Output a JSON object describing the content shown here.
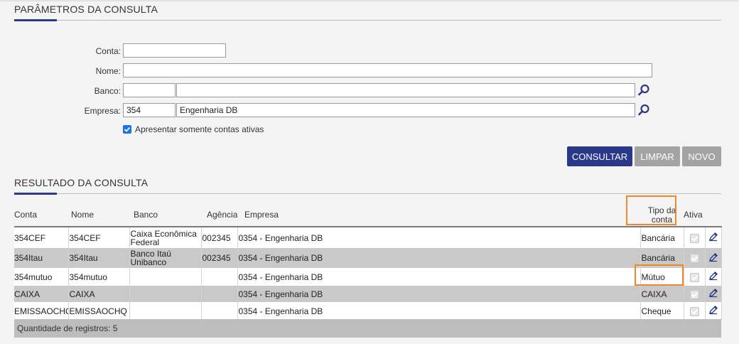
{
  "params": {
    "title": "PARÂMETROS DA CONSULTA",
    "conta_label": "Conta:",
    "conta_value": "",
    "nome_label": "Nome:",
    "nome_value": "",
    "banco_label": "Banco:",
    "banco_code": "",
    "banco_name": "",
    "empresa_label": "Empresa:",
    "empresa_code": "354",
    "empresa_name": "Engenharia DB",
    "only_active_label": "Apresentar somente contas ativas",
    "only_active_checked": true
  },
  "buttons": {
    "consultar": "CONSULTAR",
    "limpar": "LIMPAR",
    "novo": "NOVO"
  },
  "results": {
    "title": "RESULTADO DA CONSULTA",
    "columns": {
      "conta": "Conta",
      "nome": "Nome",
      "banco": "Banco",
      "agencia": "Agência",
      "empresa": "Empresa",
      "tipo": "Tipo da conta",
      "ativa": "Ativa"
    },
    "rows": [
      {
        "conta": "354CEF",
        "nome": "354CEF",
        "banco": "Caixa Econômica Federal",
        "agencia": "002345",
        "empresa": "0354 - Engenharia DB",
        "tipo": "Bancária"
      },
      {
        "conta": "354Itau",
        "nome": "354Itau",
        "banco": "Banco Itaú Unibanco",
        "agencia": "002345",
        "empresa": "0354 - Engenharia DB",
        "tipo": "Bancária"
      },
      {
        "conta": "354mutuo",
        "nome": "354mutuo",
        "banco": "",
        "agencia": "",
        "empresa": "0354 - Engenharia DB",
        "tipo": "Mútuo"
      },
      {
        "conta": "CAIXA",
        "nome": "CAIXA",
        "banco": "",
        "agencia": "",
        "empresa": "0354 - Engenharia DB",
        "tipo": "CAIXA"
      },
      {
        "conta": "EMISSAOCHQ",
        "nome": "EMISSAOCHQ",
        "banco": "",
        "agencia": "",
        "empresa": "0354 - Engenharia DB",
        "tipo": "Cheque"
      }
    ],
    "footer_label": "Quantidade de registros:",
    "footer_count": "5"
  },
  "colors": {
    "accent": "#293889",
    "highlight": "#f0882a",
    "row_alt": "#c9c9c9"
  },
  "icons": {
    "lookup": "search-icon",
    "edit": "pencil-icon",
    "active": "check-icon"
  }
}
